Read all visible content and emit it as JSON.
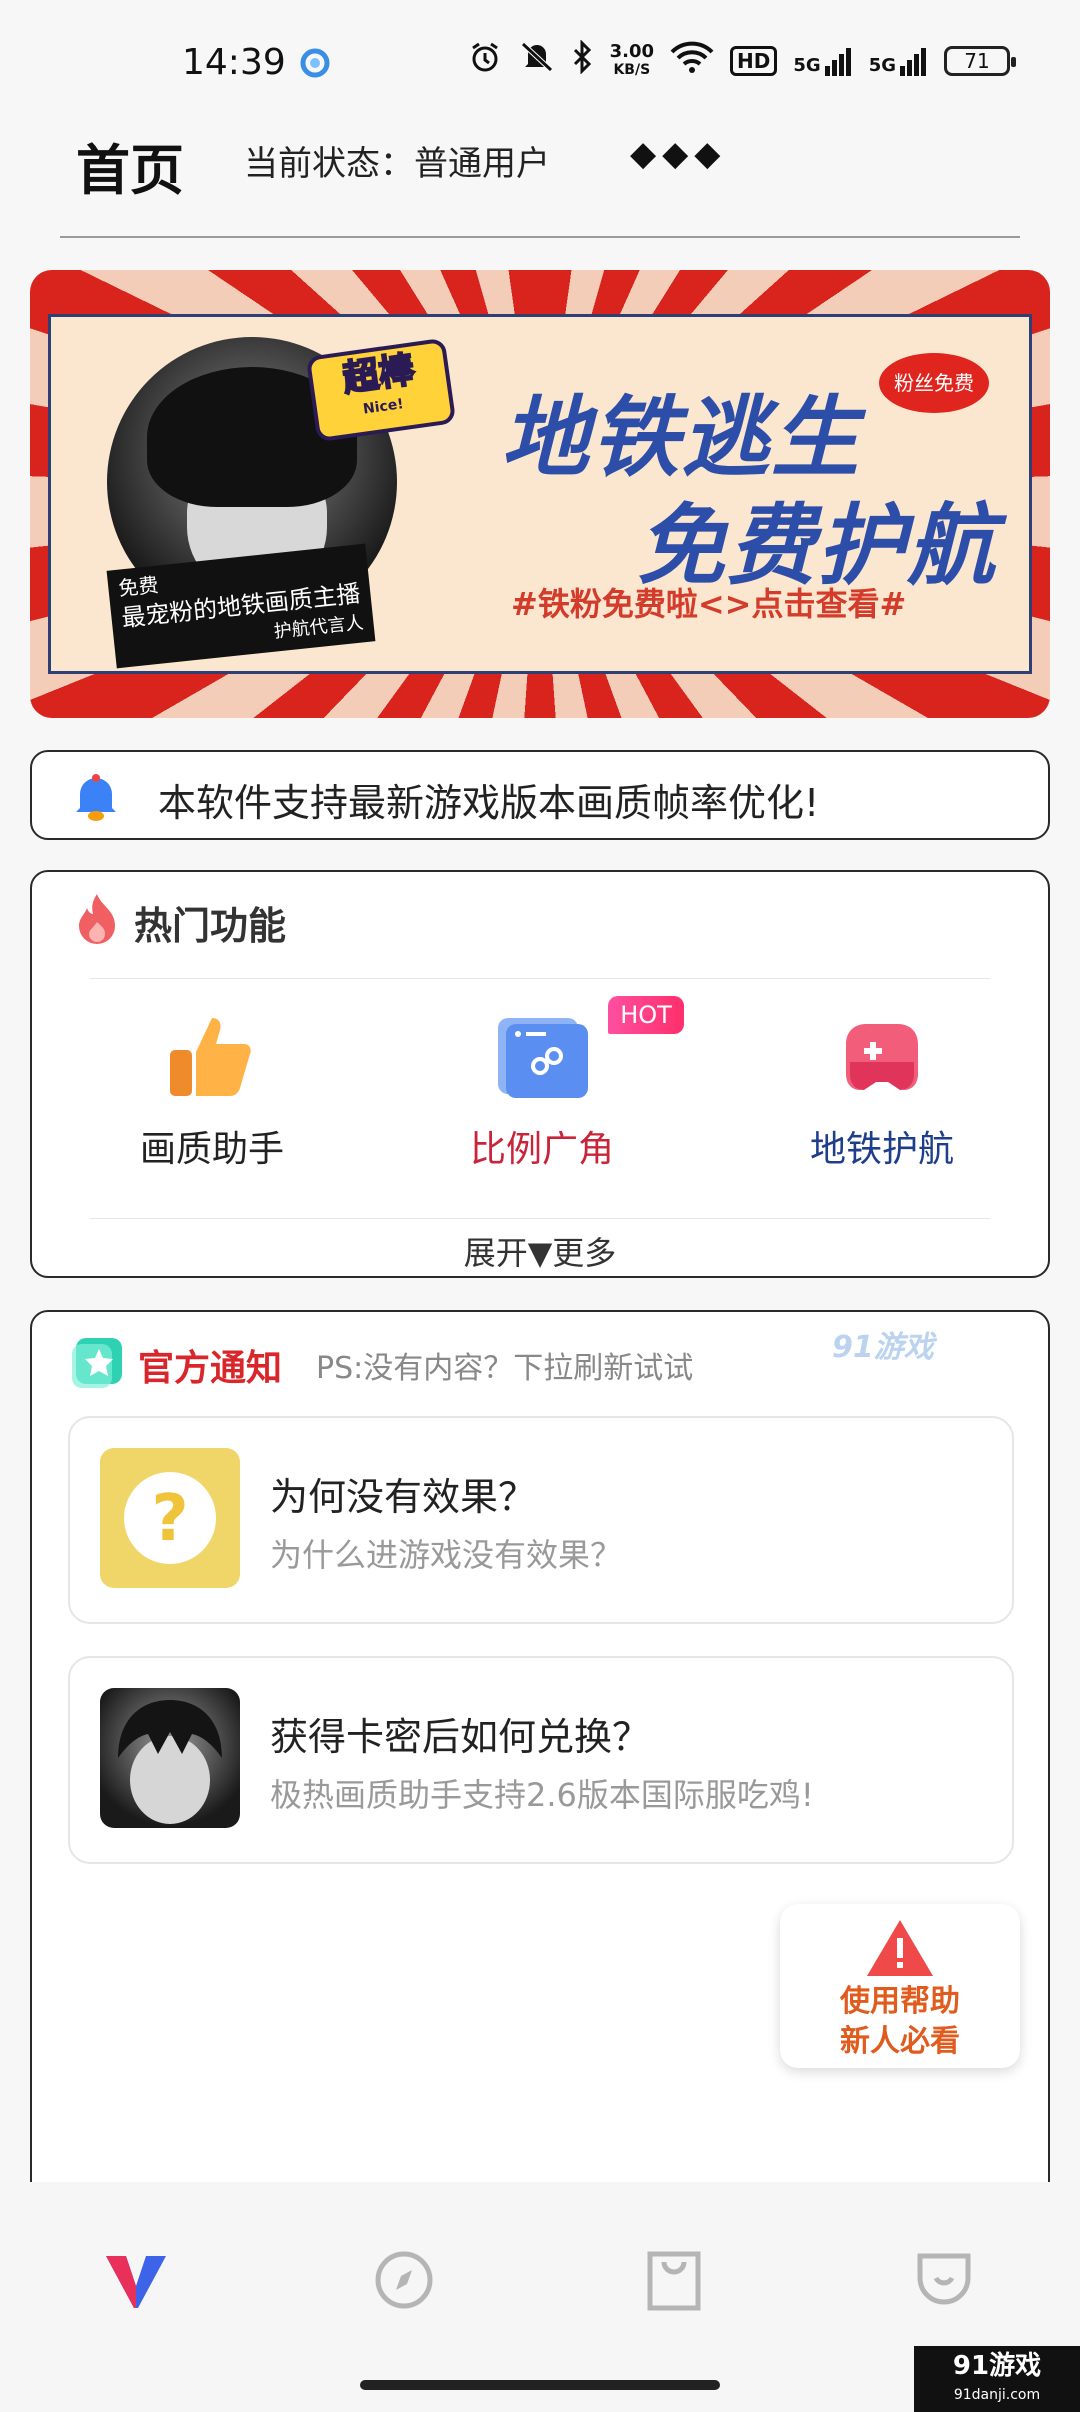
{
  "status_bar": {
    "time": "14:39",
    "speed_value": "3.00",
    "speed_unit": "KB/S",
    "network_a": "5G",
    "network_b": "5G",
    "hd_label": "HD",
    "battery": "71",
    "icons": [
      "app-icon",
      "alarm-icon",
      "mute-icon",
      "bluetooth-icon",
      "wifi-icon",
      "signal-icon"
    ]
  },
  "header": {
    "title": "首页",
    "status_label": "当前状态：",
    "status_value": "普通用户",
    "diamonds": "◆◆◆"
  },
  "banner": {
    "badge_big": "超棒",
    "badge_small": "Nice!",
    "caption_line1": "免费",
    "caption_line2": "最宠粉的地铁画质主播",
    "caption_line3": "护航代言人",
    "headline_1": "地铁逃生",
    "headline_2": "免费护航",
    "bubble": "粉丝免费",
    "subtitle": "#铁粉免费啦<>点击查看#",
    "colors": {
      "red": "#d9241e",
      "blue": "#2d4ea8",
      "cream": "#fbe7cf"
    }
  },
  "notice": {
    "text": "本软件支持最新游戏版本画质帧率优化!"
  },
  "hot_functions": {
    "title": "热门功能",
    "hot_tag": "HOT",
    "items": [
      {
        "label": "画质助手",
        "color": "#222222",
        "icon": "thumbs-up-icon"
      },
      {
        "label": "比例广角",
        "color": "#c8243a",
        "icon": "mini-program-icon"
      },
      {
        "label": "地铁护航",
        "color": "#1e3e8a",
        "icon": "gamepad-icon"
      }
    ],
    "expand": "展开▼更多"
  },
  "official": {
    "title": "官方通知",
    "hint": "PS:没有内容？下拉刷新试试",
    "watermark": "91游戏",
    "items": [
      {
        "title": "为何没有效果？",
        "subtitle": "为什么进游戏没有效果？"
      },
      {
        "title": "获得卡密后如何兑换？",
        "subtitle": "极热画质助手支持2.6版本国际服吃鸡!"
      }
    ]
  },
  "help": {
    "line1": "使用帮助",
    "line2": "新人必看"
  },
  "bottom_nav": {
    "items": [
      "home-logo-icon",
      "compass-icon",
      "bag-icon",
      "profile-icon"
    ]
  },
  "corner_watermark": {
    "main": "91游戏",
    "sub": "91danji.com"
  }
}
